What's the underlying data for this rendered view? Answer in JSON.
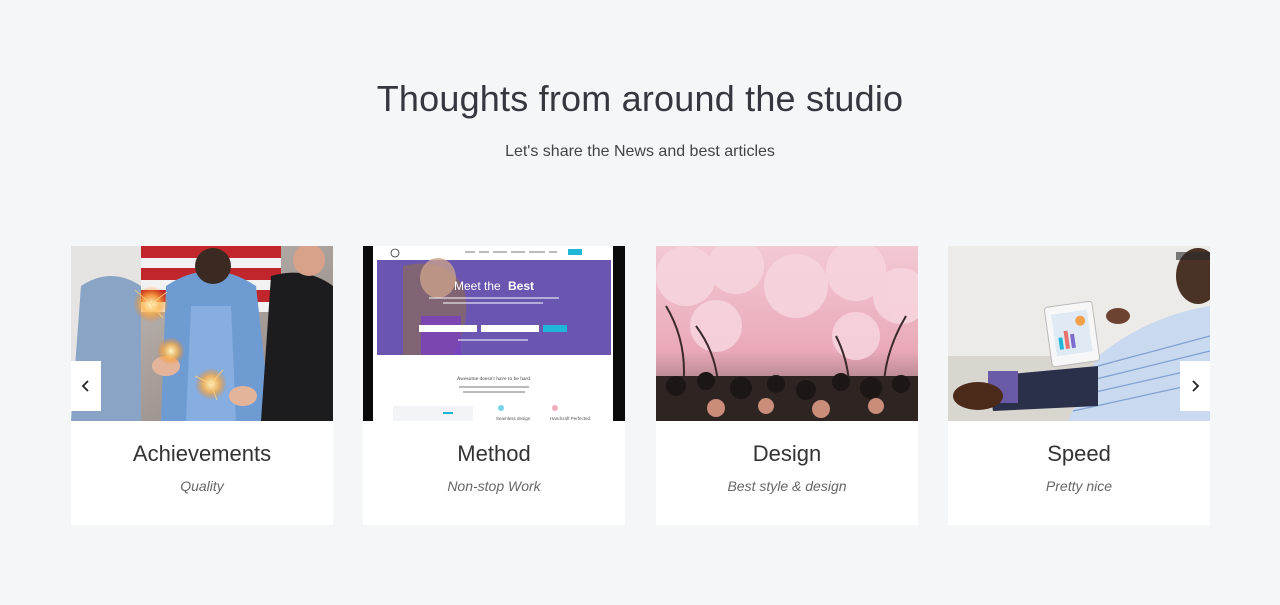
{
  "header": {
    "title": "Thoughts from around the studio",
    "subtitle": "Let's share the News and best articles"
  },
  "cards": [
    {
      "title": "Achievements",
      "subtitle": "Quality",
      "image": "sparklers-photo"
    },
    {
      "title": "Method",
      "subtitle": "Non-stop Work",
      "image": "website-screenshot",
      "screenshot": {
        "logo": "ark",
        "hero_text_1": "Meet the ",
        "hero_text_2": "Best",
        "section_heading": "Awesome doesn't have to be hard.",
        "feature_1": "Seamless design",
        "feature_2": "Handcraft Perfected"
      }
    },
    {
      "title": "Design",
      "subtitle": "Best style & design",
      "image": "cherry-blossom-photo"
    },
    {
      "title": "Speed",
      "subtitle": "Pretty nice",
      "image": "tablet-man-photo"
    }
  ],
  "carousel": {
    "prev_icon": "chevron-left-icon",
    "next_icon": "chevron-right-icon"
  },
  "colors": {
    "background": "#f5f6f8",
    "card": "#ffffff",
    "title": "#34373d",
    "accent": "#1fb6d8",
    "hero_purple": "#6a56b0"
  }
}
